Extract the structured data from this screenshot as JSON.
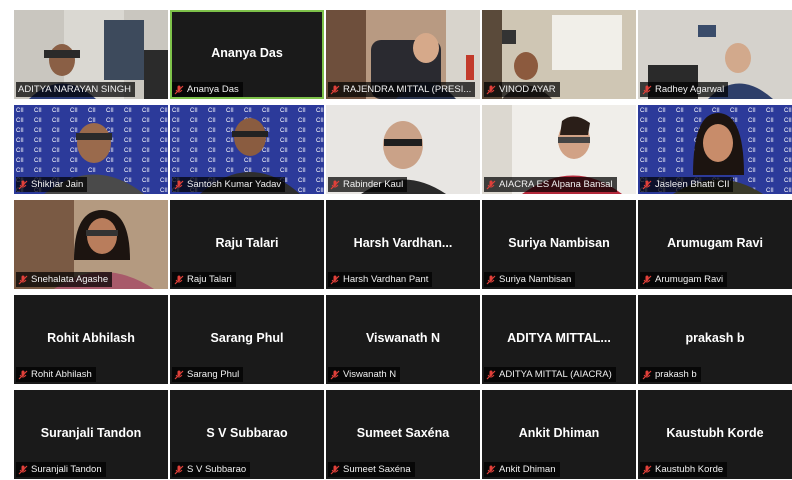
{
  "participants": [
    {
      "label": "ADITYA NARAYAN SINGH",
      "display": "",
      "video": true,
      "mic": "muted"
    },
    {
      "label": "Ananya Das",
      "display": "Ananya Das",
      "video": false,
      "mic": "muted",
      "active": true
    },
    {
      "label": "RAJENDRA MITTAL (PRESI...",
      "display": "",
      "video": true,
      "mic": "muted"
    },
    {
      "label": "VINOD AYAR",
      "display": "",
      "video": true,
      "mic": "muted"
    },
    {
      "label": "Radhey Agarwal",
      "display": "",
      "video": true,
      "mic": "muted"
    },
    {
      "label": "Shikhar Jain",
      "display": "",
      "video": true,
      "mic": "muted"
    },
    {
      "label": "Santosh Kumar Yadav",
      "display": "",
      "video": true,
      "mic": "muted"
    },
    {
      "label": "Rabinder Kaul",
      "display": "",
      "video": true,
      "mic": "muted"
    },
    {
      "label": "AIACRA ES Alpana Bansal",
      "display": "",
      "video": true,
      "mic": "muted"
    },
    {
      "label": "Jasleen Bhatti CII",
      "display": "",
      "video": true,
      "mic": "muted"
    },
    {
      "label": "Snehalata Agashe",
      "display": "",
      "video": true,
      "mic": "muted"
    },
    {
      "label": "Raju Talari",
      "display": "Raju Talari",
      "video": false,
      "mic": "muted"
    },
    {
      "label": "Harsh Vardhan Pant",
      "display": "Harsh  Vardhan...",
      "video": false,
      "mic": "muted"
    },
    {
      "label": "Suriya Nambisan",
      "display": "Suriya Nambisan",
      "video": false,
      "mic": "muted"
    },
    {
      "label": "Arumugam Ravi",
      "display": "Arumugam Ravi",
      "video": false,
      "mic": "muted"
    },
    {
      "label": "Rohit Abhilash",
      "display": "Rohit Abhilash",
      "video": false,
      "mic": "muted"
    },
    {
      "label": "Sarang Phul",
      "display": "Sarang Phul",
      "video": false,
      "mic": "muted"
    },
    {
      "label": "Viswanath N",
      "display": "Viswanath N",
      "video": false,
      "mic": "muted"
    },
    {
      "label": "ADITYA MITTAL (AIACRA)",
      "display": "ADITYA MITTAL...",
      "video": false,
      "mic": "muted"
    },
    {
      "label": "prakash b",
      "display": "prakash b",
      "video": false,
      "mic": "muted"
    },
    {
      "label": "Suranjali Tandon",
      "display": "Suranjali Tandon",
      "video": false,
      "mic": "muted"
    },
    {
      "label": "S V Subbarao",
      "display": "S V Subbarao",
      "video": false,
      "mic": "muted"
    },
    {
      "label": "Sumeet Saxéna",
      "display": "Sumeet Saxéna",
      "video": false,
      "mic": "muted"
    },
    {
      "label": "Ankit Dhiman",
      "display": "Ankit Dhiman",
      "video": false,
      "mic": "muted"
    },
    {
      "label": "Kaustubh Korde",
      "display": "Kaustubh Korde",
      "video": false,
      "mic": "muted"
    }
  ],
  "colors": {
    "muted_icon": "#e0403a",
    "active_speaker": "#7ec24a",
    "tile_bg": "#1a1a1a",
    "logo_wall": "#2c3a9a"
  }
}
